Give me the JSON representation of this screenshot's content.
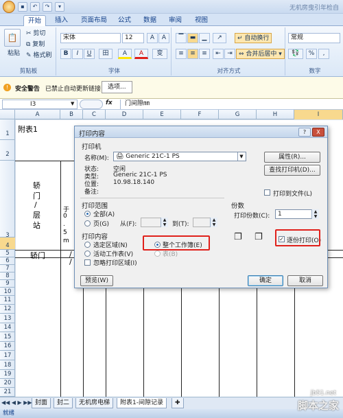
{
  "app": {
    "title": "无机房曳引年检自",
    "qat": [
      "save-icon",
      "undo-icon",
      "redo-icon",
      "customize-icon"
    ]
  },
  "tabs": [
    "开始",
    "插入",
    "页面布局",
    "公式",
    "数据",
    "审阅",
    "视图"
  ],
  "ribbon": {
    "clipboard": {
      "paste": "粘贴",
      "cut": "剪切",
      "copy": "复制",
      "format_painter": "格式刷",
      "label": "剪贴板"
    },
    "font": {
      "name": "宋体",
      "size": "12",
      "grow": "A",
      "shrink": "A",
      "bold": "B",
      "italic": "I",
      "underline": "U",
      "border": "田",
      "fill": "A",
      "color": "A",
      "phonetic": "变",
      "label": "字体"
    },
    "alignment": {
      "wrap": "自动换行",
      "merge": "合并后居中",
      "label": "对齐方式"
    },
    "number": {
      "format": "常规",
      "percent": "%",
      "comma": ",",
      "label": "数字"
    }
  },
  "security": {
    "title": "安全警告",
    "text": "已禁止自动更新链接",
    "options": "选项..."
  },
  "formula_bar": {
    "cell_ref": "I3",
    "fx": "fx",
    "content": "门间隙㎜"
  },
  "columns": [
    "A",
    "B",
    "C",
    "D",
    "E",
    "F",
    "G",
    "H",
    "I"
  ],
  "rows": [
    "1",
    "2",
    "3",
    "4",
    "5",
    "6",
    "7",
    "8",
    "9",
    "10",
    "11",
    "12",
    "13",
    "14",
    "15",
    "16",
    "17",
    "18",
    "19",
    "20",
    "21",
    "22",
    "23"
  ],
  "cells": {
    "a1": "附表1",
    "a3_line1": "轿",
    "a3_line2": "门",
    "a3_line3": "/",
    "a3_line4": "层",
    "a3_line5": "站",
    "a5": "轿门",
    "b5": "/",
    "b6": "/",
    "b3_partial": "于",
    "b3_partial2": "0",
    "b3_partial3": ".",
    "b3_partial4": "5",
    "b3_partial5": "m"
  },
  "sheets": [
    "封面",
    "封二",
    "无机房电梯",
    "附表1-间隙记录"
  ],
  "status": "就绪",
  "watermark": {
    "brand": "脚本之家",
    "url": "jb51.net"
  },
  "dialog": {
    "title": "打印内容",
    "help": "?",
    "close": "X",
    "printer": {
      "section": "打印机",
      "name_label": "名称(M):",
      "name_value": "Generic 21C-1 PS",
      "status_label": "状态:",
      "status_value": "空闲",
      "type_label": "类型:",
      "type_value": "Generic 21C-1 PS",
      "location_label": "位置:",
      "location_value": "10.98.18.140",
      "comment_label": "备注:",
      "comment_value": "",
      "properties": "属性(R)...",
      "find_printer": "查找打印机(D)...",
      "print_to_file": "打印到文件(L)"
    },
    "range": {
      "section": "打印范围",
      "all": "全部(A)",
      "pages": "页(G)",
      "from_label": "从(F):",
      "to_label": "到(T):",
      "from_value": "",
      "to_value": ""
    },
    "copies": {
      "section": "份数",
      "count_label": "打印份数(C):",
      "count_value": "1",
      "collate": "逐份打印(O)"
    },
    "content": {
      "section": "打印内容",
      "selection": "选定区域(N)",
      "workbook": "整个工作簿(E)",
      "active_sheets": "活动工作表(V)",
      "table": "表(B)",
      "ignore_print_area": "忽略打印区域(I)"
    },
    "preview": "预览(W)",
    "ok": "确定",
    "cancel": "取消"
  }
}
